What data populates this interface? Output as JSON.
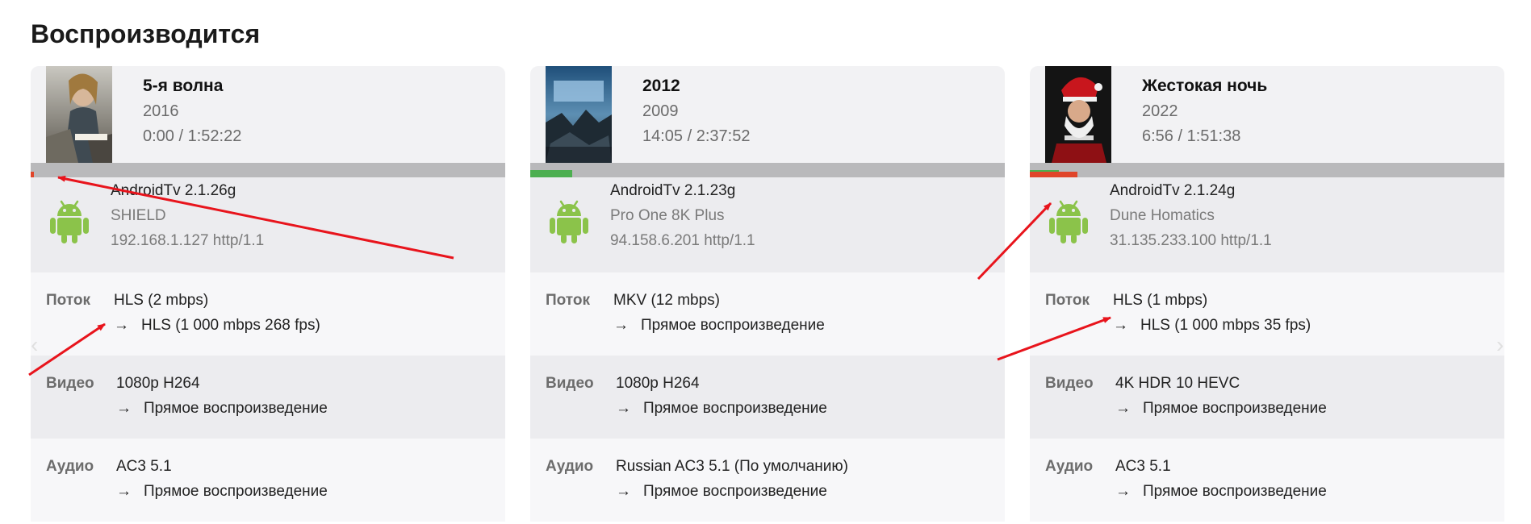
{
  "section_title": "Воспроизводится",
  "sessions": [
    {
      "title": "5-я волна",
      "year": "2016",
      "time": "0:00 / 1:52:22",
      "progress": {
        "buffered_fraction": 0.0,
        "played_fraction": 0.006
      },
      "device": {
        "client": "AndroidTv 2.1.26g",
        "name": "SHIELD",
        "address": "192.168.1.127 http/1.1"
      },
      "stream": {
        "label": "Поток",
        "source": "HLS (2 mbps)",
        "target": "HLS (1 000 mbps 268 fps)"
      },
      "video": {
        "label": "Видео",
        "source": "1080p H264",
        "target": "Прямое воспроизведение"
      },
      "audio": {
        "label": "Аудио",
        "source": "AC3 5.1",
        "target": "Прямое воспроизведение"
      }
    },
    {
      "title": "2012",
      "year": "2009",
      "time": "14:05 / 2:37:52",
      "progress": {
        "buffered_fraction": 0.089,
        "played_fraction": 0.0
      },
      "device": {
        "client": "AndroidTv 2.1.23g",
        "name": "Pro One 8K Plus",
        "address": "94.158.6.201 http/1.1"
      },
      "stream": {
        "label": "Поток",
        "source": "MKV (12 mbps)",
        "target": "Прямое воспроизведение"
      },
      "video": {
        "label": "Видео",
        "source": "1080p H264",
        "target": "Прямое воспроизведение"
      },
      "audio": {
        "label": "Аудио",
        "source": "Russian AC3 5.1 (По умолчанию)",
        "target": "Прямое воспроизведение"
      }
    },
    {
      "title": "Жестокая ночь",
      "year": "2022",
      "time": "6:56 / 1:51:38",
      "progress": {
        "buffered_fraction": 0.062,
        "played_fraction": 0.1
      },
      "device": {
        "client": "AndroidTv 2.1.24g",
        "name": "Dune Homatics",
        "address": "31.135.233.100 http/1.1"
      },
      "stream": {
        "label": "Поток",
        "source": "HLS (1 mbps)",
        "target": "HLS (1 000 mbps 35 fps)"
      },
      "video": {
        "label": "Видео",
        "source": "4K HDR 10 HEVC",
        "target": "Прямое воспроизведение"
      },
      "audio": {
        "label": "Аудио",
        "source": "AC3 5.1",
        "target": "Прямое воспроизведение"
      }
    }
  ],
  "arrow_glyph": "→",
  "icons": {
    "device_icon": "android-icon",
    "nav_prev": "chevron-left-icon",
    "nav_next": "chevron-right-icon"
  },
  "colors": {
    "android_green": "#8bc34a",
    "buffer_bar": "#4caf50",
    "play_bar": "#e0452a",
    "annotation_arrow": "#e8141c"
  }
}
